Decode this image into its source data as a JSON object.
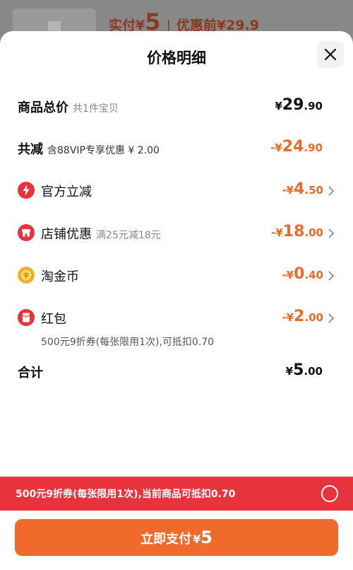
{
  "backdrop": {
    "prefix": "实付",
    "currency": "¥",
    "price": "5",
    "original": "优惠前¥29.9"
  },
  "sheet": {
    "title": "价格明细"
  },
  "rows": {
    "total": {
      "label": "商品总价",
      "sub": "共1件宝贝",
      "currency": "¥",
      "int": "29",
      "dec": ".90"
    },
    "reduce": {
      "label": "共减",
      "sub": "含88VIP专享优惠 ¥ 2.00",
      "sign": "-",
      "currency": "¥",
      "int": "24",
      "dec": ".90"
    },
    "official": {
      "label": "官方立减",
      "icon": "lightning-icon",
      "sign": "-",
      "currency": "¥",
      "int": "4",
      "dec": ".50"
    },
    "shop": {
      "label": "店铺优惠",
      "sub": "满25元减18元",
      "icon": "shop-icon",
      "sign": "-",
      "currency": "¥",
      "int": "18",
      "dec": ".00"
    },
    "coin": {
      "label": "淘金币",
      "icon": "coin-icon",
      "sign": "-",
      "currency": "¥",
      "int": "0",
      "dec": ".40"
    },
    "redpacket": {
      "label": "红包",
      "note": "500元9折券(每张限用1次),可抵扣0.70",
      "icon": "red-packet-icon",
      "sign": "-",
      "currency": "¥",
      "int": "2",
      "dec": ".00"
    },
    "sum": {
      "label": "合计",
      "currency": "¥",
      "int": "5",
      "dec": ".00"
    }
  },
  "banner": {
    "text": "500元9折券(每张限用1次),当前商品可抵扣0.70"
  },
  "pay": {
    "label": "立即支付",
    "currency": "¥",
    "int": "5"
  },
  "colors": {
    "accent": "#ef6a2b",
    "banner": "#e8333d",
    "discount": "#ea6a2a"
  }
}
